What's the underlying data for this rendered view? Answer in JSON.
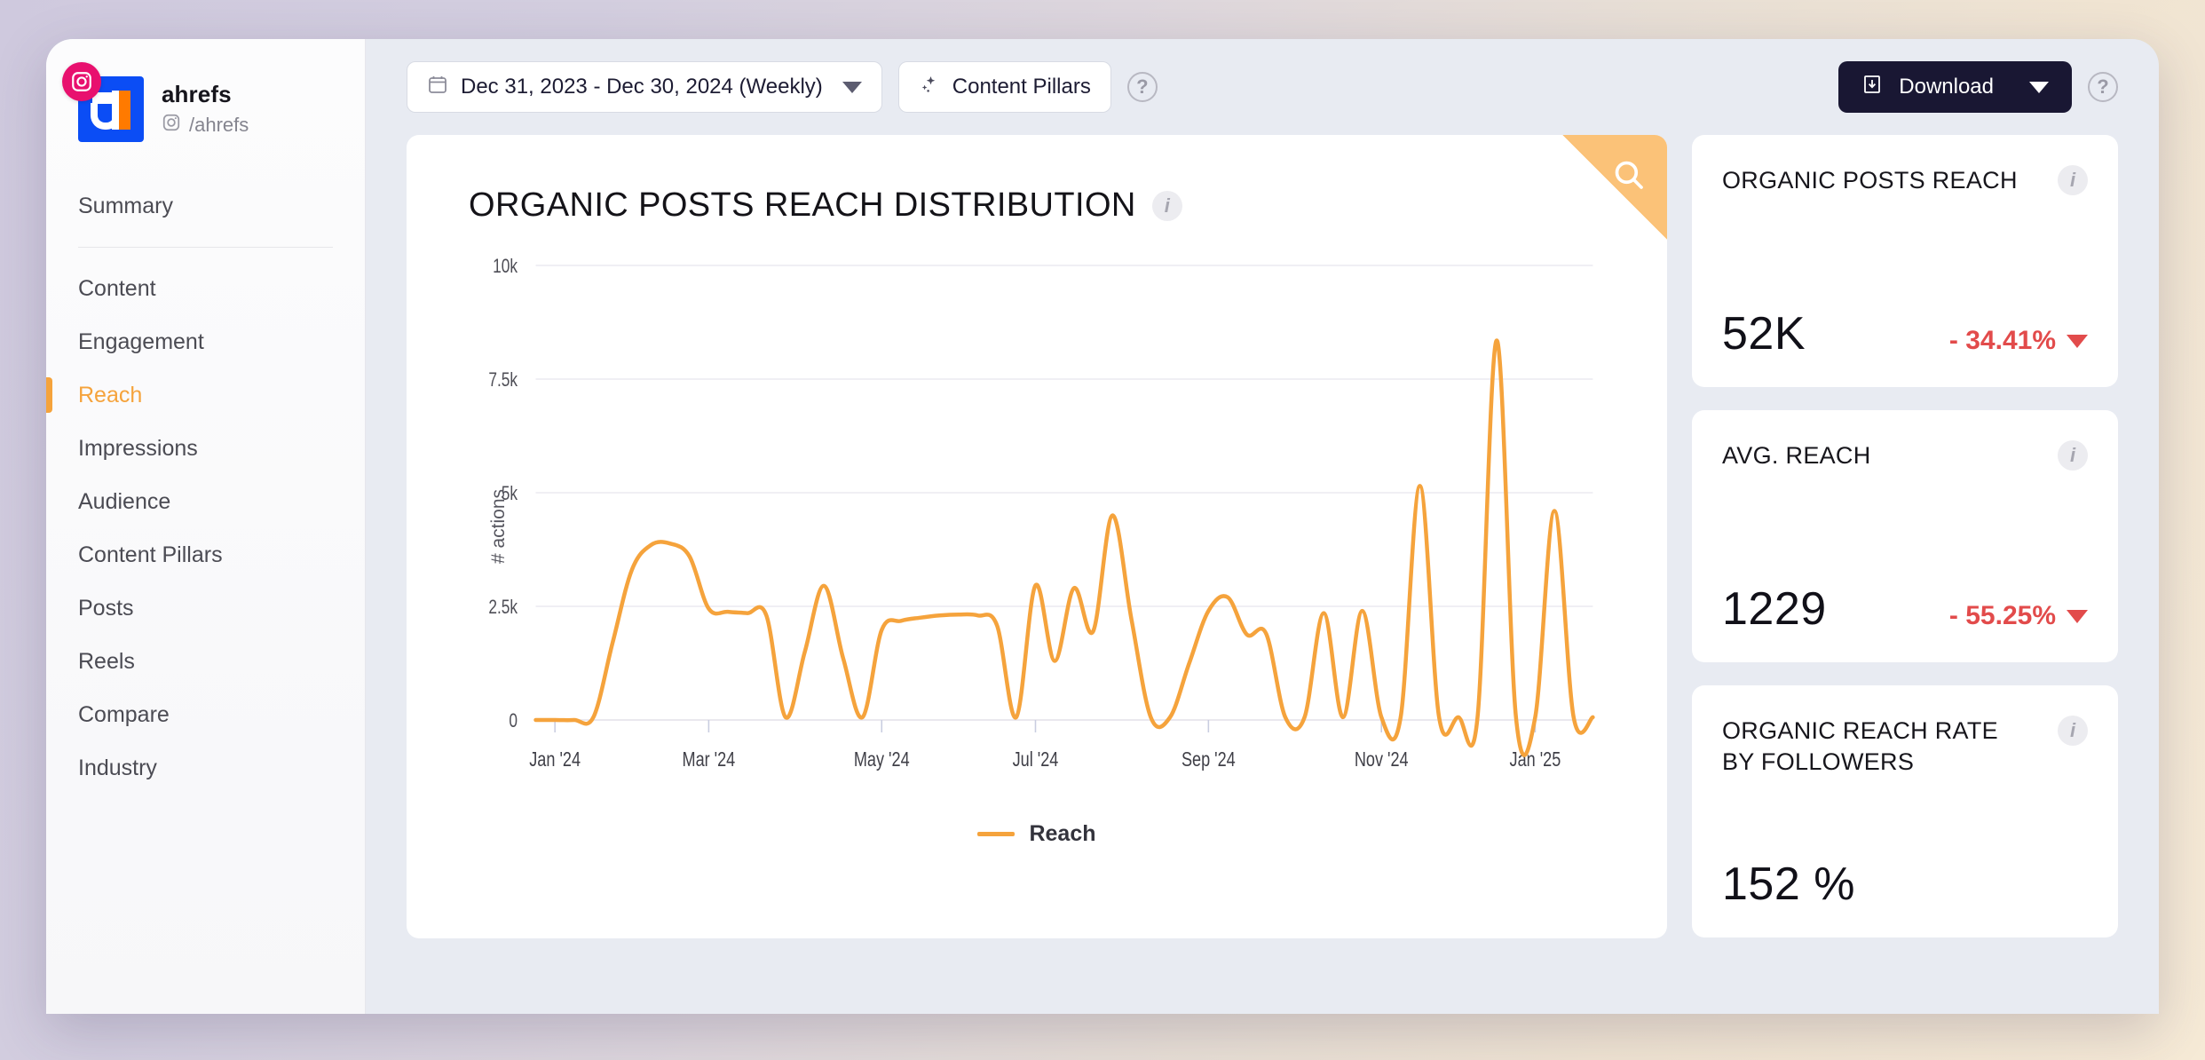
{
  "brand": {
    "name": "ahrefs",
    "handle": "/ahrefs",
    "platform_icon": "instagram-icon",
    "badge_color": "#e8106e",
    "avatar_color": "#0b4df5"
  },
  "sidebar": {
    "items": [
      {
        "label": "Summary",
        "active": false
      },
      {
        "label": "Content",
        "active": false
      },
      {
        "label": "Engagement",
        "active": false
      },
      {
        "label": "Reach",
        "active": true
      },
      {
        "label": "Impressions",
        "active": false
      },
      {
        "label": "Audience",
        "active": false
      },
      {
        "label": "Content Pillars",
        "active": false
      },
      {
        "label": "Posts",
        "active": false
      },
      {
        "label": "Reels",
        "active": false
      },
      {
        "label": "Compare",
        "active": false
      },
      {
        "label": "Industry",
        "active": false
      }
    ],
    "active_color": "#f5a33c"
  },
  "toolbar": {
    "date_range_label": "Dec 31, 2023 - Dec 30, 2024 (Weekly)",
    "date_range_icon": "calendar-icon",
    "content_pillars_label": "Content Pillars",
    "content_pillars_icon": "sparkle-icon",
    "help_label": "?",
    "download_label": "Download",
    "download_icon": "download-icon",
    "download_bg": "#191733"
  },
  "chart_card": {
    "title": "ORGANIC POSTS REACH DISTRIBUTION",
    "info_label": "i",
    "zoom_icon": "magnifier-icon",
    "corner_color": "#fbc278"
  },
  "chart_data": {
    "type": "line",
    "title": "ORGANIC POSTS REACH DISTRIBUTION",
    "xlabel": "",
    "ylabel": "# actions",
    "ylim": [
      0,
      10000
    ],
    "yticks": [
      0,
      2500,
      5000,
      7500,
      10000
    ],
    "ytick_labels": [
      "0",
      "2.5k",
      "5k",
      "7.5k",
      "10k"
    ],
    "xtick_labels": [
      "Jan '24",
      "Mar '24",
      "May '24",
      "Jul '24",
      "Sep '24",
      "Nov '24",
      "Jan '25"
    ],
    "xtick_positions": [
      1,
      9,
      18,
      26,
      35,
      44,
      52
    ],
    "grid": true,
    "legend_position": "bottom",
    "line_color": "#f5a33c",
    "series": [
      {
        "name": "Reach",
        "values": [
          0,
          0,
          0,
          60,
          1700,
          3300,
          3850,
          3880,
          3600,
          2450,
          2380,
          2350,
          2300,
          60,
          1500,
          2950,
          1350,
          60,
          1980,
          2180,
          2250,
          2300,
          2320,
          2300,
          2080,
          60,
          2960,
          1300,
          2900,
          1950,
          4500,
          2200,
          60,
          60,
          1250,
          2400,
          2700,
          1880,
          1900,
          60,
          60,
          2350,
          60,
          2400,
          60,
          60,
          5150,
          60,
          60,
          60,
          8350,
          60,
          60,
          4600,
          60,
          60
        ]
      }
    ]
  },
  "legend": {
    "label": "Reach",
    "color": "#f5a33c"
  },
  "metrics": [
    {
      "label": "ORGANIC POSTS REACH",
      "value": "52K",
      "delta": "- 34.41%",
      "delta_direction": "down",
      "delta_color": "#e24b4b",
      "info_label": "i"
    },
    {
      "label": "AVG. REACH",
      "value": "1229",
      "delta": "- 55.25%",
      "delta_direction": "down",
      "delta_color": "#e24b4b",
      "info_label": "i"
    },
    {
      "label": "ORGANIC REACH RATE BY FOLLOWERS",
      "value": "152 %",
      "delta": "",
      "delta_direction": "none",
      "delta_color": "#e24b4b",
      "info_label": "i"
    }
  ]
}
